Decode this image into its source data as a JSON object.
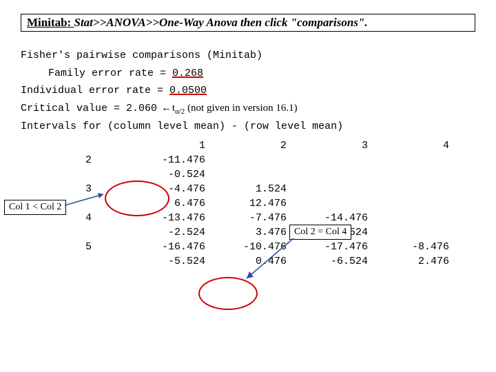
{
  "title": {
    "lead_u": "Minitab: ",
    "rest_it": "Stat>>ANOVA>>One-Way Anova then click \"comparisons\"."
  },
  "lines": {
    "l1": "Fisher's pairwise comparisons (Minitab)",
    "l2a": "Family error rate = ",
    "l2b": "0.268",
    "l3a": "Individual error rate = ",
    "l3b": "0.0500",
    "l4a": "Critical value = 2.060 ",
    "l4arrow": "←",
    "l4b": " t",
    "l4sub": "α/2",
    "l4c": " (not given in version 16.1)",
    "l5": "Intervals for (column level mean) - (row level mean)"
  },
  "table": {
    "c1": "1",
    "c2": "2",
    "c3": "3",
    "c4": "4",
    "r2": "2",
    "r2_1a": "-11.476",
    "r2_1b": "-0.524",
    "r3": "3",
    "r3_1a": "-4.476",
    "r3_1b": "6.476",
    "r3_2a": "1.524",
    "r3_2b": "12.476",
    "r4": "4",
    "r4_1a": "-13.476",
    "r4_1b": "-2.524",
    "r4_2a": "-7.476",
    "r4_2b": "3.476",
    "r4_3a": "-14.476",
    "r4_3b": "-3.524",
    "r5": "5",
    "r5_1a": "-16.476",
    "r5_1b": "-5.524",
    "r5_2a": "-10.476",
    "r5_2b": "0.476",
    "r5_3a": "-17.476",
    "r5_3b": "-6.524",
    "r5_4a": "-8.476",
    "r5_4b": "2.476"
  },
  "notes": {
    "n1": "Col 1 < Col 2",
    "n2": "Col 2 = Col 4"
  }
}
